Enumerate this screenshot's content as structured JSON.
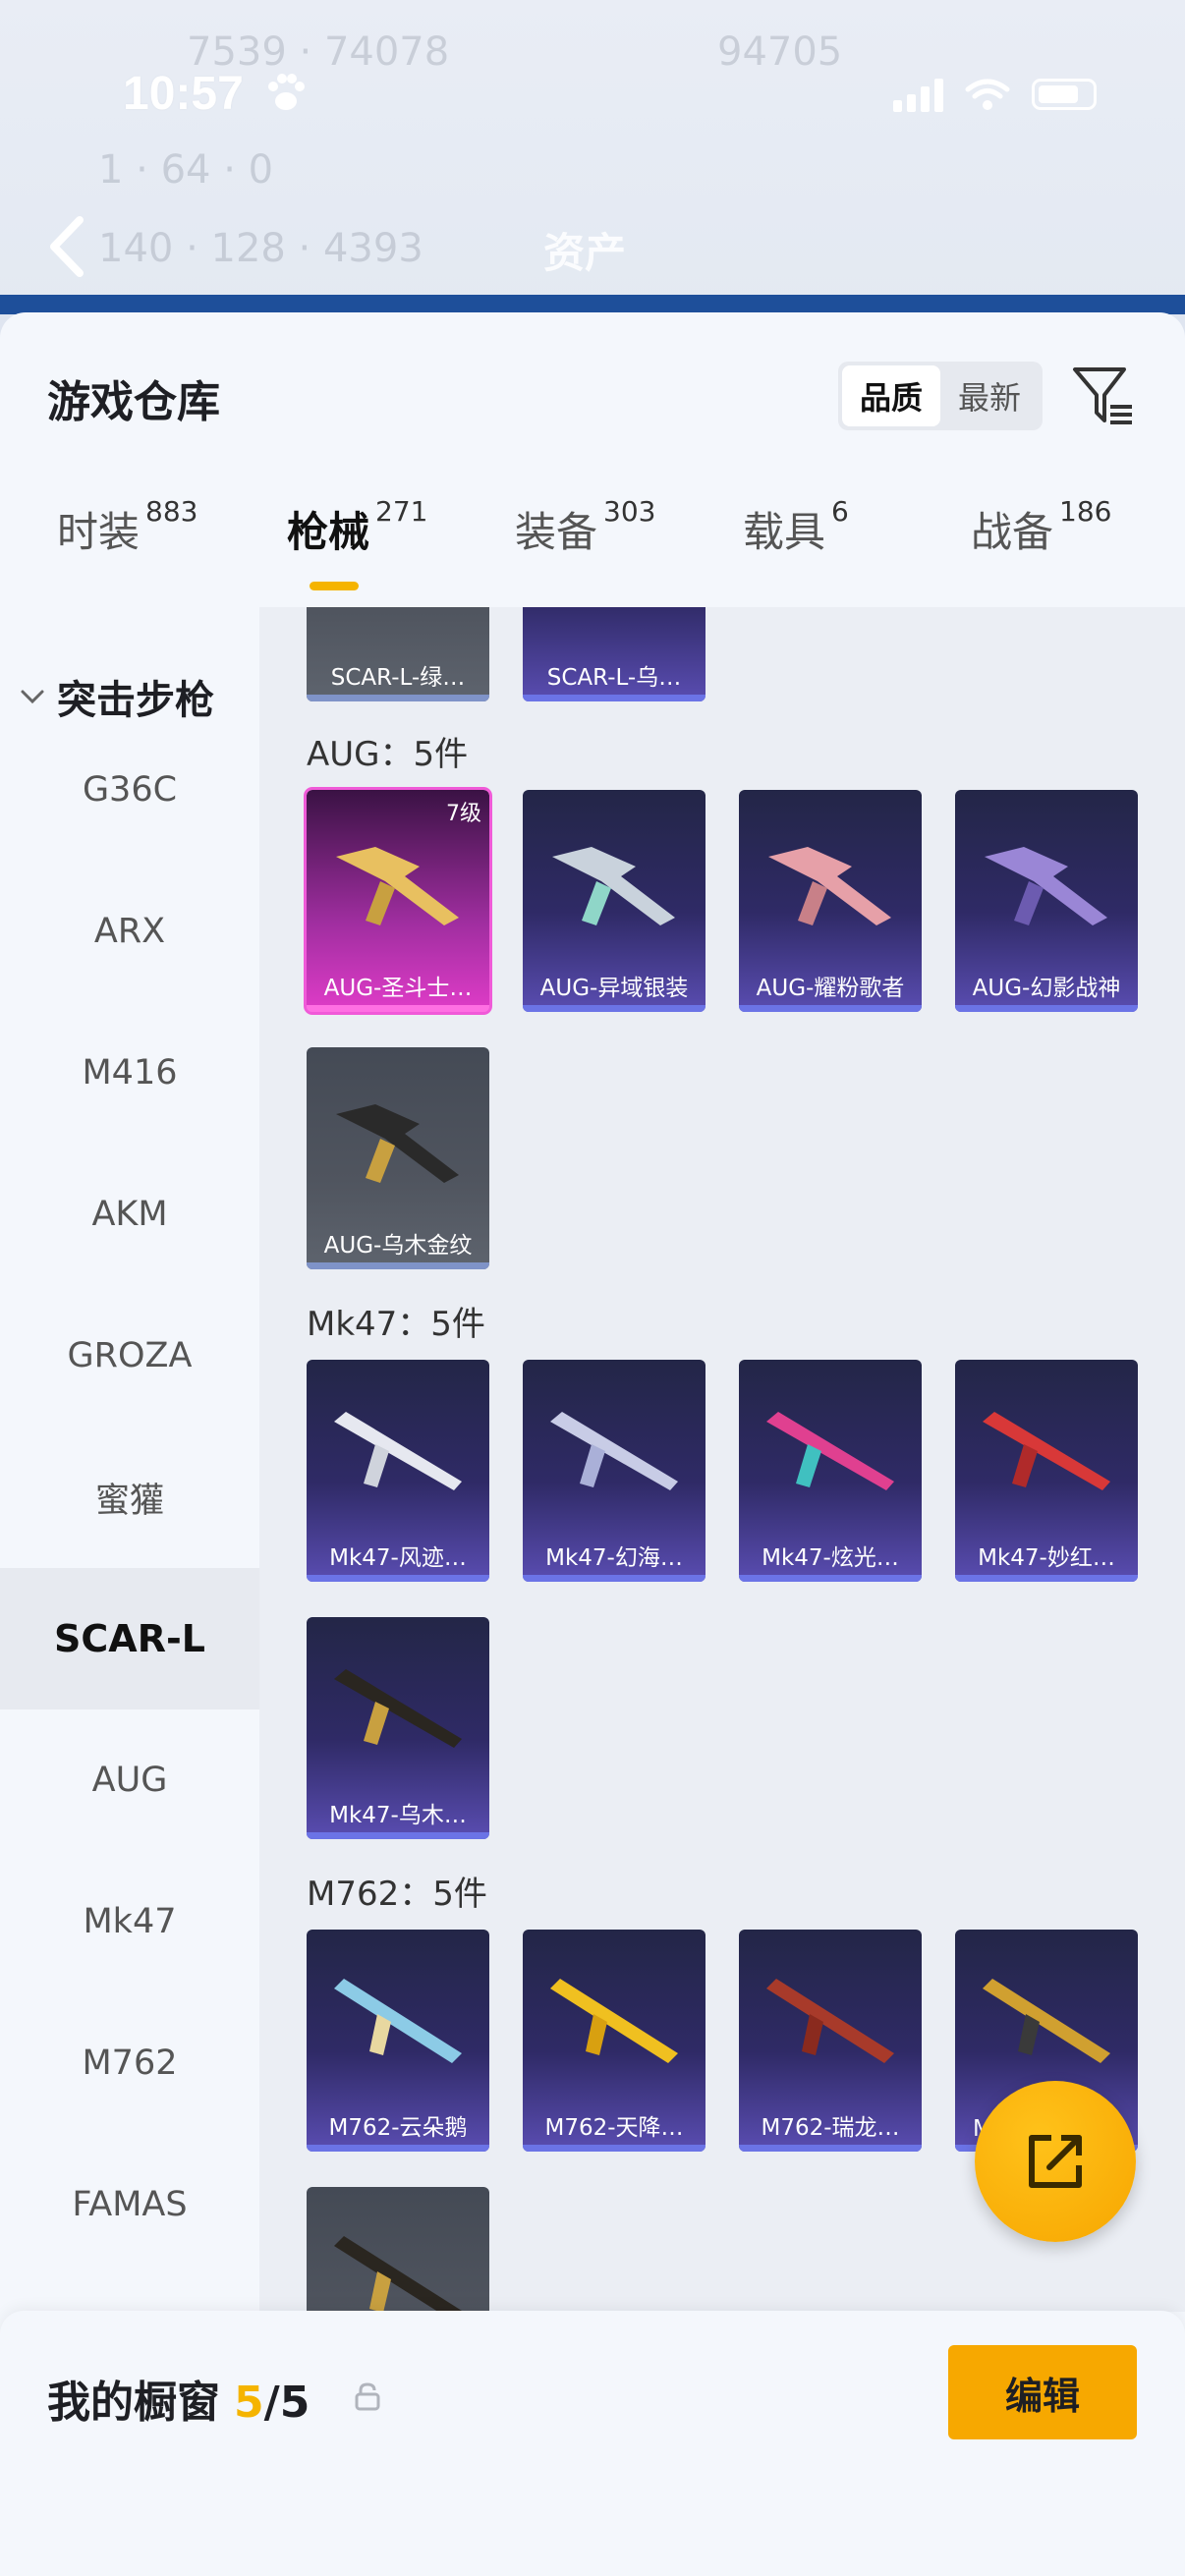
{
  "status": {
    "time": "10:57"
  },
  "header": {
    "title": "资产"
  },
  "sheet": {
    "title": "游戏仓库",
    "sort_options": [
      "品质",
      "最新"
    ],
    "sort_selected": "品质"
  },
  "tabs": [
    {
      "label": "时装",
      "count": "883"
    },
    {
      "label": "枪械",
      "count": "271",
      "active": true
    },
    {
      "label": "装备",
      "count": "303"
    },
    {
      "label": "载具",
      "count": "6"
    },
    {
      "label": "战备",
      "count": "186"
    }
  ],
  "sidebar": {
    "group": "突击步枪",
    "items": [
      "G36C",
      "ARX",
      "M416",
      "AKM",
      "GROZA",
      "蜜獾",
      "SCAR-L",
      "AUG",
      "Mk47",
      "M762",
      "FAMAS"
    ],
    "active": "SCAR-L"
  },
  "content": {
    "scar_cards": [
      "SCAR-L-绿…",
      "SCAR-L-乌…"
    ],
    "aug": {
      "title": "AUG：5件",
      "cards": [
        "AUG-圣斗士…",
        "AUG-异域银装",
        "AUG-耀粉歌者",
        "AUG-幻影战神",
        "AUG-乌木金纹"
      ],
      "first_level": "7级"
    },
    "mk47": {
      "title": "Mk47：5件",
      "cards": [
        "Mk47-风迹…",
        "Mk47-幻海…",
        "Mk47-炫光…",
        "Mk47-妙红…",
        "Mk47-乌木…"
      ]
    },
    "m762": {
      "title": "M762：5件",
      "cards": [
        "M762-云朵鹅",
        "M762-天降…",
        "M762-瑞龙…",
        "M"
      ]
    }
  },
  "bottom": {
    "label": "我的橱窗",
    "current": "5",
    "total": "/5",
    "edit_label": "编辑"
  },
  "colors": {
    "accent": "#f7a800",
    "purple_card": "#2f2a66",
    "pink_card": "#e03cc8"
  },
  "icons": [
    "paw-icon",
    "signal-icon",
    "wifi-icon",
    "battery-icon",
    "back-icon",
    "filter-icon",
    "chevron-down-icon",
    "lock-icon",
    "share-icon"
  ]
}
